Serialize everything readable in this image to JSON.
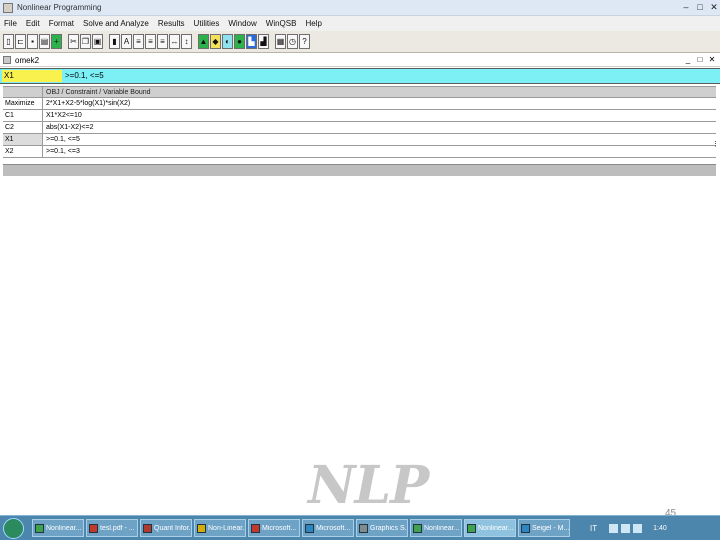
{
  "app": {
    "title": "Nonlinear Programming",
    "window_controls": [
      "–",
      "□",
      "✕"
    ]
  },
  "menu": [
    "File",
    "Edit",
    "Format",
    "Solve and Analyze",
    "Results",
    "Utilities",
    "Window",
    "WinQSB",
    "Help"
  ],
  "child_window": {
    "title": "omek2",
    "controls": [
      "_",
      "□",
      "✕"
    ]
  },
  "cell_editor": {
    "ref": "X1",
    "content": ">=0.1, <=5"
  },
  "grid": {
    "header": "OBJ / Constraint / Variable Bound",
    "rows": [
      {
        "label": "Maximize",
        "value": "2*X1+X2-5*log(X1)*sin(X2)"
      },
      {
        "label": "C1",
        "value": "X1*X2<=10"
      },
      {
        "label": "C2",
        "value": "abs(X1-X2)<=2"
      },
      {
        "label": "X1",
        "value": ">=0.1, <=5"
      },
      {
        "label": "X2",
        "value": ">=0.1, <=3"
      }
    ]
  },
  "slide": {
    "watermark": "NLP",
    "page_number": "45"
  },
  "taskbar": {
    "tasks": [
      {
        "label": "Nonlinear...",
        "color": "#3fa34d"
      },
      {
        "label": "tesl.pdf - ...",
        "color": "#c0392b"
      },
      {
        "label": "Quant Infor...",
        "color": "#b03a2e"
      },
      {
        "label": "Non-Linear...",
        "color": "#d4ac0d"
      },
      {
        "label": "Microsoft...",
        "color": "#c0392b"
      },
      {
        "label": "Microsoft...",
        "color": "#2e86c1"
      },
      {
        "label": "Graphics S...",
        "color": "#7f8c8d"
      },
      {
        "label": "Nonlinear...",
        "color": "#3fa34d"
      },
      {
        "label": "Nonlinear...",
        "color": "#3fa34d"
      },
      {
        "label": "Seigel - M...",
        "color": "#2e86c1"
      }
    ],
    "active_task": 8,
    "language": "IT",
    "clock": "1:40"
  }
}
